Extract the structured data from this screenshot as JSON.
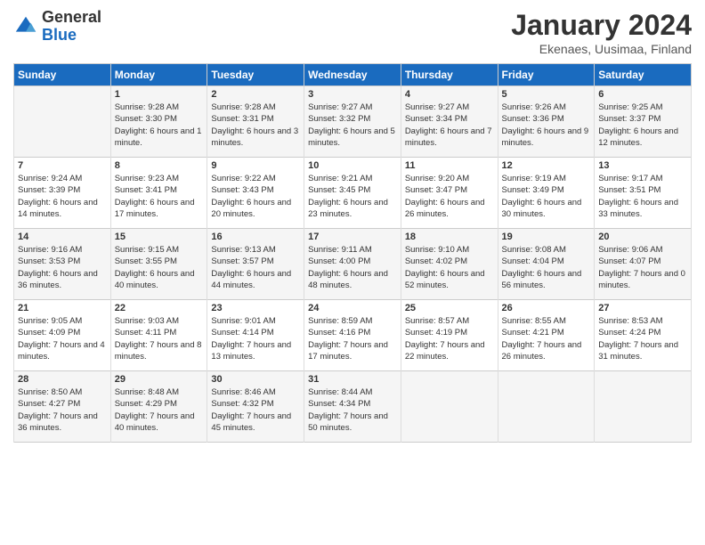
{
  "header": {
    "logo_general": "General",
    "logo_blue": "Blue",
    "month_title": "January 2024",
    "location": "Ekenaes, Uusimaa, Finland"
  },
  "weekdays": [
    "Sunday",
    "Monday",
    "Tuesday",
    "Wednesday",
    "Thursday",
    "Friday",
    "Saturday"
  ],
  "weeks": [
    [
      {
        "day": "",
        "sunrise": "",
        "sunset": "",
        "daylight": ""
      },
      {
        "day": "1",
        "sunrise": "Sunrise: 9:28 AM",
        "sunset": "Sunset: 3:30 PM",
        "daylight": "Daylight: 6 hours and 1 minute."
      },
      {
        "day": "2",
        "sunrise": "Sunrise: 9:28 AM",
        "sunset": "Sunset: 3:31 PM",
        "daylight": "Daylight: 6 hours and 3 minutes."
      },
      {
        "day": "3",
        "sunrise": "Sunrise: 9:27 AM",
        "sunset": "Sunset: 3:32 PM",
        "daylight": "Daylight: 6 hours and 5 minutes."
      },
      {
        "day": "4",
        "sunrise": "Sunrise: 9:27 AM",
        "sunset": "Sunset: 3:34 PM",
        "daylight": "Daylight: 6 hours and 7 minutes."
      },
      {
        "day": "5",
        "sunrise": "Sunrise: 9:26 AM",
        "sunset": "Sunset: 3:36 PM",
        "daylight": "Daylight: 6 hours and 9 minutes."
      },
      {
        "day": "6",
        "sunrise": "Sunrise: 9:25 AM",
        "sunset": "Sunset: 3:37 PM",
        "daylight": "Daylight: 6 hours and 12 minutes."
      }
    ],
    [
      {
        "day": "7",
        "sunrise": "Sunrise: 9:24 AM",
        "sunset": "Sunset: 3:39 PM",
        "daylight": "Daylight: 6 hours and 14 minutes."
      },
      {
        "day": "8",
        "sunrise": "Sunrise: 9:23 AM",
        "sunset": "Sunset: 3:41 PM",
        "daylight": "Daylight: 6 hours and 17 minutes."
      },
      {
        "day": "9",
        "sunrise": "Sunrise: 9:22 AM",
        "sunset": "Sunset: 3:43 PM",
        "daylight": "Daylight: 6 hours and 20 minutes."
      },
      {
        "day": "10",
        "sunrise": "Sunrise: 9:21 AM",
        "sunset": "Sunset: 3:45 PM",
        "daylight": "Daylight: 6 hours and 23 minutes."
      },
      {
        "day": "11",
        "sunrise": "Sunrise: 9:20 AM",
        "sunset": "Sunset: 3:47 PM",
        "daylight": "Daylight: 6 hours and 26 minutes."
      },
      {
        "day": "12",
        "sunrise": "Sunrise: 9:19 AM",
        "sunset": "Sunset: 3:49 PM",
        "daylight": "Daylight: 6 hours and 30 minutes."
      },
      {
        "day": "13",
        "sunrise": "Sunrise: 9:17 AM",
        "sunset": "Sunset: 3:51 PM",
        "daylight": "Daylight: 6 hours and 33 minutes."
      }
    ],
    [
      {
        "day": "14",
        "sunrise": "Sunrise: 9:16 AM",
        "sunset": "Sunset: 3:53 PM",
        "daylight": "Daylight: 6 hours and 36 minutes."
      },
      {
        "day": "15",
        "sunrise": "Sunrise: 9:15 AM",
        "sunset": "Sunset: 3:55 PM",
        "daylight": "Daylight: 6 hours and 40 minutes."
      },
      {
        "day": "16",
        "sunrise": "Sunrise: 9:13 AM",
        "sunset": "Sunset: 3:57 PM",
        "daylight": "Daylight: 6 hours and 44 minutes."
      },
      {
        "day": "17",
        "sunrise": "Sunrise: 9:11 AM",
        "sunset": "Sunset: 4:00 PM",
        "daylight": "Daylight: 6 hours and 48 minutes."
      },
      {
        "day": "18",
        "sunrise": "Sunrise: 9:10 AM",
        "sunset": "Sunset: 4:02 PM",
        "daylight": "Daylight: 6 hours and 52 minutes."
      },
      {
        "day": "19",
        "sunrise": "Sunrise: 9:08 AM",
        "sunset": "Sunset: 4:04 PM",
        "daylight": "Daylight: 6 hours and 56 minutes."
      },
      {
        "day": "20",
        "sunrise": "Sunrise: 9:06 AM",
        "sunset": "Sunset: 4:07 PM",
        "daylight": "Daylight: 7 hours and 0 minutes."
      }
    ],
    [
      {
        "day": "21",
        "sunrise": "Sunrise: 9:05 AM",
        "sunset": "Sunset: 4:09 PM",
        "daylight": "Daylight: 7 hours and 4 minutes."
      },
      {
        "day": "22",
        "sunrise": "Sunrise: 9:03 AM",
        "sunset": "Sunset: 4:11 PM",
        "daylight": "Daylight: 7 hours and 8 minutes."
      },
      {
        "day": "23",
        "sunrise": "Sunrise: 9:01 AM",
        "sunset": "Sunset: 4:14 PM",
        "daylight": "Daylight: 7 hours and 13 minutes."
      },
      {
        "day": "24",
        "sunrise": "Sunrise: 8:59 AM",
        "sunset": "Sunset: 4:16 PM",
        "daylight": "Daylight: 7 hours and 17 minutes."
      },
      {
        "day": "25",
        "sunrise": "Sunrise: 8:57 AM",
        "sunset": "Sunset: 4:19 PM",
        "daylight": "Daylight: 7 hours and 22 minutes."
      },
      {
        "day": "26",
        "sunrise": "Sunrise: 8:55 AM",
        "sunset": "Sunset: 4:21 PM",
        "daylight": "Daylight: 7 hours and 26 minutes."
      },
      {
        "day": "27",
        "sunrise": "Sunrise: 8:53 AM",
        "sunset": "Sunset: 4:24 PM",
        "daylight": "Daylight: 7 hours and 31 minutes."
      }
    ],
    [
      {
        "day": "28",
        "sunrise": "Sunrise: 8:50 AM",
        "sunset": "Sunset: 4:27 PM",
        "daylight": "Daylight: 7 hours and 36 minutes."
      },
      {
        "day": "29",
        "sunrise": "Sunrise: 8:48 AM",
        "sunset": "Sunset: 4:29 PM",
        "daylight": "Daylight: 7 hours and 40 minutes."
      },
      {
        "day": "30",
        "sunrise": "Sunrise: 8:46 AM",
        "sunset": "Sunset: 4:32 PM",
        "daylight": "Daylight: 7 hours and 45 minutes."
      },
      {
        "day": "31",
        "sunrise": "Sunrise: 8:44 AM",
        "sunset": "Sunset: 4:34 PM",
        "daylight": "Daylight: 7 hours and 50 minutes."
      },
      {
        "day": "",
        "sunrise": "",
        "sunset": "",
        "daylight": ""
      },
      {
        "day": "",
        "sunrise": "",
        "sunset": "",
        "daylight": ""
      },
      {
        "day": "",
        "sunrise": "",
        "sunset": "",
        "daylight": ""
      }
    ]
  ]
}
